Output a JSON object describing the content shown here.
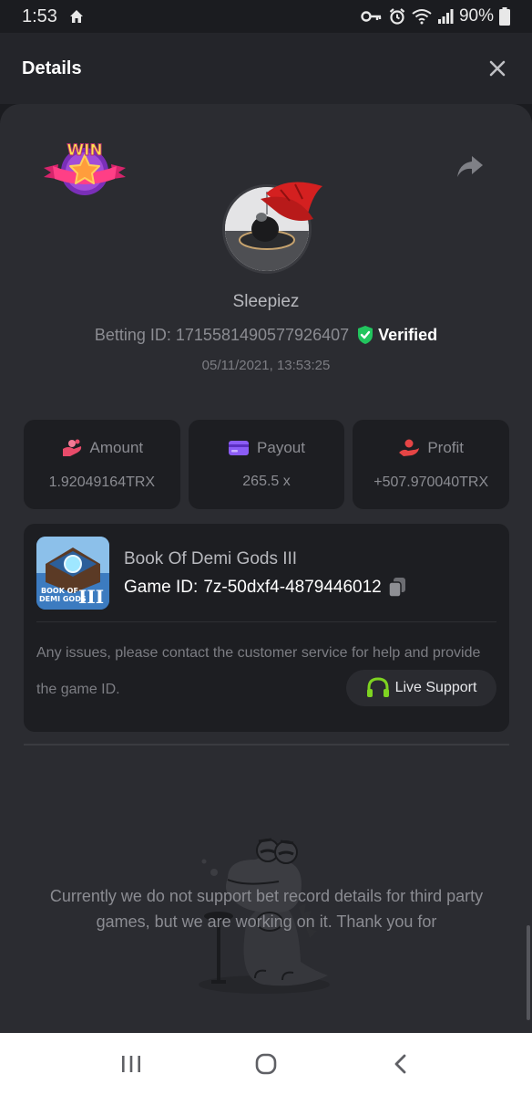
{
  "status_bar": {
    "time": "1:53",
    "battery": "90%"
  },
  "header": {
    "title": "Details"
  },
  "bet": {
    "username": "Sleepiez",
    "betting_id_label": "Betting ID: 1715581490577926407",
    "verified_label": "Verified",
    "timestamp": "05/11/2021, 13:53:25",
    "win_badge_text": "WIN"
  },
  "stats": [
    {
      "label": "Amount",
      "value": "1.92049164TRX",
      "icon": "coins-icon",
      "color": "#e84b6a"
    },
    {
      "label": "Payout",
      "value": "265.5 x",
      "icon": "card-icon",
      "color": "#8b5cf6"
    },
    {
      "label": "Profit",
      "value": "+507.970040TRX",
      "icon": "hand-money-icon",
      "color": "#e64545"
    }
  ],
  "game": {
    "title": "Book Of Demi Gods III",
    "id_label": "Game ID:",
    "id_value": "7z-50dxf4-4879446012",
    "thumb_text_1": "BOOK OF",
    "thumb_text_2": "DEMI GODS",
    "thumb_text_3": "III",
    "issue_text": "Any issues, please contact the customer service for help and provide the game ID.",
    "live_support_label": "Live Support"
  },
  "footer": {
    "message": "Currently we do not support bet record details for third party games, but we are working on it. Thank you for"
  },
  "colors": {
    "verified": "#22c55e",
    "live_support_icon": "#7ed321"
  }
}
